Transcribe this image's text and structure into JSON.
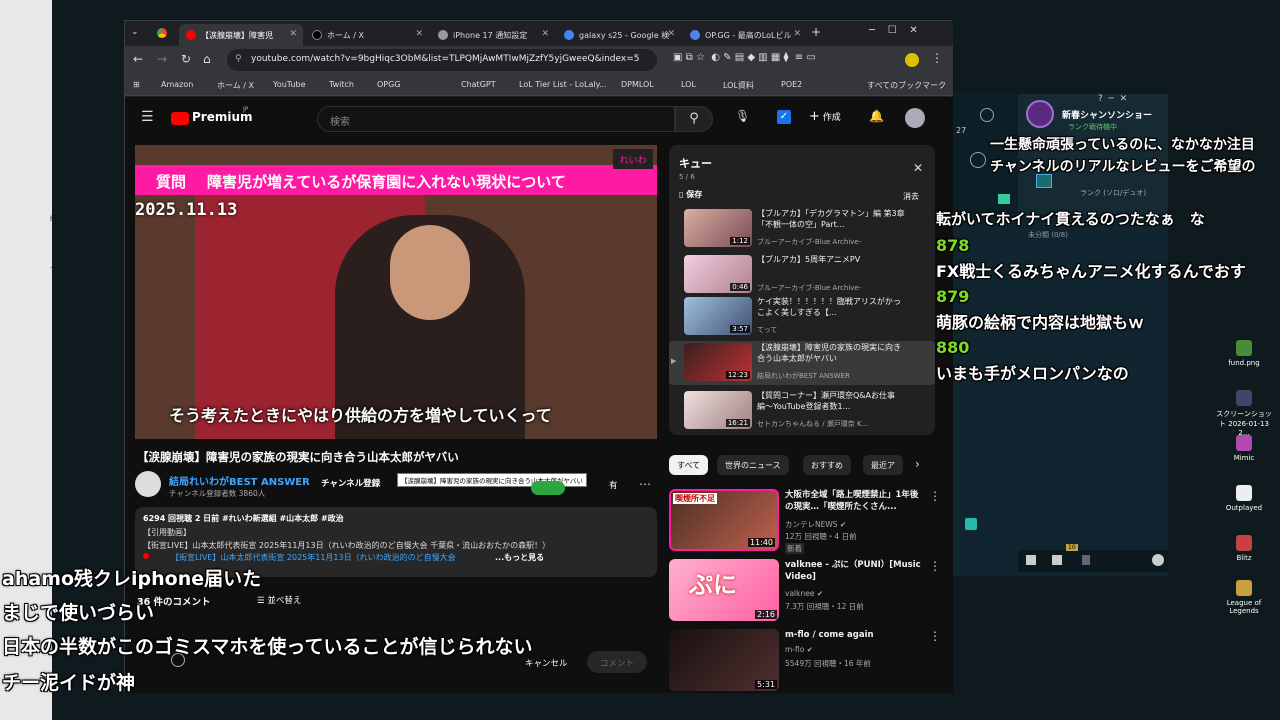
{
  "browser": {
    "tabs": [
      {
        "label": "【涙腺崩壊】障害児",
        "active": true
      },
      {
        "label": "ホーム / X",
        "active": false
      },
      {
        "label": "iPhone 17 通知設定",
        "active": false
      },
      {
        "label": "galaxy s25 - Google 検",
        "active": false
      },
      {
        "label": "OP.GG - 最高のLoLビル",
        "active": false
      }
    ],
    "url": "youtube.com/watch?v=9bgHiqc3ObM&list=TLPQMjAwMTIwMjZzfY5yjGweeQ&index=5",
    "bookmarks": [
      "Amazon",
      "ホーム / X",
      "YouTube",
      "Twitch",
      "OPGG",
      "ChatGPT",
      "LoL Tier List - LoLaly...",
      "DPMLOL",
      "LOL",
      "LOL資料",
      "POE2",
      "すべてのブックマーク"
    ]
  },
  "youtube": {
    "logo": "Premium",
    "logo_sup": "JP",
    "search_placeholder": "検索",
    "create_label": "作成",
    "video": {
      "banner_q": "質問",
      "banner_text": "障害児が増えているが保育園に入れない現状について",
      "date": "2025.11.13",
      "subtitle": "そう考えたときにやはり供給の方を増やしていくって",
      "logo": "れいわ"
    },
    "title": "【涙腺崩壊】障害児の家族の現実に向き合う山本太郎がヤバい",
    "tooltip": "【涙腺崩壊】障害児の家族の現実に向き合う山本太郎がヤバい",
    "channel": {
      "name": "結局れいわがBEST ANSWER",
      "subs": "チャンネル登録者数 3860人",
      "subscribe": "チャンネル登録"
    },
    "share_fragment": "有",
    "description": {
      "stats": "6294 回視聴  2 日前  #れいわ新選組 #山本太郎 #政治",
      "line1": "【引用動画】",
      "line2": "【街宣LIVE】山本太郎代表街宣 2025年11月13日（れいわ政治的のど自慢大会 千葉県・流山おおたかの森駅！）",
      "line3": "【街宣LIVE】山本太郎代表街宣 2025年11月13日（れいわ政治的のど自慢大会",
      "more": "...もっと見る"
    },
    "comments": {
      "count": "36 件のコメント",
      "sort": "並べ替え",
      "cancel": "キャンセル",
      "submit": "コメント"
    },
    "queue": {
      "title": "キュー",
      "position": "5 / 6",
      "save": "保存",
      "clear": "消去",
      "items": [
        {
          "title": "【ブルアカ】「デカグラマトン」編 第3章「不観一体の空」Part...",
          "channel": "ブルーアーカイブ-Blue Archive-",
          "duration": "1:12"
        },
        {
          "title": "【ブルアカ】5周年アニメPV",
          "channel": "ブルーアーカイブ-Blue Archive-",
          "duration": "0:46"
        },
        {
          "title": "ケイ実装！！！！！！臨戦アリスがかっこよく美しすぎる【...",
          "channel": "てって",
          "duration": "3:57"
        },
        {
          "title": "【涙腺崩壊】障害児の家族の現実に向き合う山本太郎がヤバい",
          "channel": "結局れいわがBEST ANSWER",
          "duration": "12:23"
        },
        {
          "title": "【質問コーナー】瀬戸環奈Q&Aお仕事編〜YouTube登録者数1...",
          "channel": "セトカンちゃんねる / 瀬戸環奈 K...",
          "duration": "16:21"
        }
      ]
    },
    "chips": [
      "すべて",
      "世界のニュース",
      "おすすめ",
      "最近ア"
    ],
    "recommendations": [
      {
        "title": "大阪市全域「路上喫煙禁止」1年後の現実…「喫煙所たくさん...",
        "channel": "カンテレNEWS",
        "meta": "12万 回視聴・4 日前",
        "badge": "新着",
        "duration": "11:40",
        "thumb_text": "喫煙所不足"
      },
      {
        "title": "valknee - ぷに（PUNI）[Music Video]",
        "channel": "valknee",
        "meta": "7.3万 回視聴・12 日前",
        "badge": "",
        "duration": "2:16",
        "thumb_text": "ぷに"
      },
      {
        "title": "m-flo / come again",
        "channel": "m-flo",
        "meta": "5549万 回視聴・16 年前",
        "badge": "",
        "duration": "5:31",
        "thumb_text": ""
      }
    ]
  },
  "overlay_comments_left": [
    "ahamo残クレiphone届いた",
    "まじで使いづらい",
    "日本の半数がこのゴミスマホを使っていることが信じられない",
    "チー泥イドが神"
  ],
  "overlay_comments_right": {
    "top_line1": "一生懸命頑張っているのに、なかなか注目",
    "top_line2": "チャンネルのリアルなレビューをご希望の",
    "line3": "転がいてホイナイ貫えるのつたなぁ　な",
    "items": [
      {
        "num": "878",
        "text": "FX戦士くるみちゃんアニメ化するんでおす"
      },
      {
        "num": "879",
        "text": "萌豚の絵柄で内容は地獄もｗ"
      },
      {
        "num": "880",
        "text": "いまも手がメロンパンなの"
      }
    ]
  },
  "game_widget": {
    "title": "新春シャンソンショー",
    "status": "ランク戦待機中",
    "rank": "ランク (ソロ/デュオ)",
    "unassigned": "未分類 (0/8)",
    "level": "27",
    "count": "10"
  },
  "desktop_icons": [
    {
      "label": "fund.png"
    },
    {
      "label": "スクリーンショット 2026-01-13 2..."
    },
    {
      "label": "Mimic"
    },
    {
      "label": "Outplayed"
    },
    {
      "label": "Blitz"
    },
    {
      "label": "League of Legends"
    }
  ],
  "left_strip_frags": [
    "her",
    "ート"
  ],
  "colors": {
    "yt_red": "#ff0000",
    "banner_pink": "#ff1aa3",
    "green_comment": "#7ddc1f",
    "bg": "#0f0f0f"
  }
}
